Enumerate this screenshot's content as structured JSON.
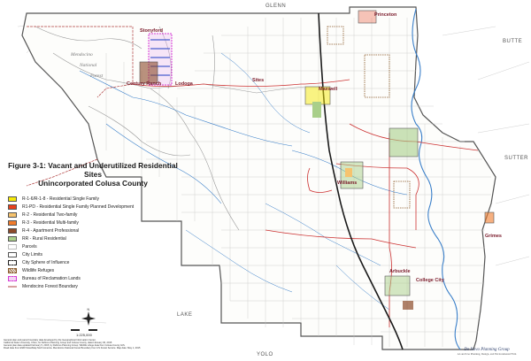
{
  "legend": {
    "title_line1": "Figure 3-1: Vacant and Underutilized Residential Sites",
    "title_line2": "Unincorporated Colusa County",
    "items": [
      {
        "label": "R-1-6/R-1-8 - Residential Single Family",
        "color": "#f5e90a",
        "style": "fill"
      },
      {
        "label": "R1-PD - Residential Single Family Planned Development",
        "color": "#e8401c",
        "style": "fill"
      },
      {
        "label": "R-2 - Residential Two-family",
        "color": "#f6c36e",
        "style": "fill"
      },
      {
        "label": "R-3 - Residential Multi-family",
        "color": "#f07b2c",
        "style": "fill"
      },
      {
        "label": "R-4 - Apartment Professional",
        "color": "#8c4a2a",
        "style": "fill"
      },
      {
        "label": "RR - Rural Residential",
        "color": "#a9cf8a",
        "style": "fill"
      },
      {
        "label": "Parcels",
        "color": "#bbbbbb",
        "style": "outline"
      },
      {
        "label": "City Limits",
        "color": "#555555",
        "style": "outline"
      },
      {
        "label": "City Sphere of Influence",
        "color": "#222222",
        "style": "dashed"
      },
      {
        "label": "Wildlife Refuges",
        "color": "#8a5a2a",
        "style": "hatch"
      },
      {
        "label": "Bureau of Reclamation Lands",
        "color": "#d63ad6",
        "style": "dashed-pink"
      },
      {
        "label": "Mendocino Forest Boundary",
        "color": "#b04040",
        "style": "line"
      }
    ]
  },
  "adjacent_counties": {
    "north": "GLENN",
    "northeast": "BUTTE",
    "east": "SUTTER",
    "south": "YOLO",
    "southwest": "LAKE"
  },
  "forest_label": [
    "Mendocino",
    "National",
    "Forest"
  ],
  "places": {
    "stonyford": "Stonyford",
    "century_ranch": "Century Ranch",
    "lodoga": "Lodoga",
    "sites": "Sites",
    "princeton": "Princeton",
    "maxwell": "Maxwell",
    "williams": "Williams",
    "grimes": "Grimes",
    "arbuckle": "Arbuckle",
    "college_city": "College City"
  },
  "scale_text": "1:225,000",
  "footnote": [
    "General plan and parcel boundary data developed by the Geographical Information Center,",
    "California State University, Chico, for DeNovo Planning Group and Colusa County, dated January 30, 2015",
    "General plan data updated February 5, 2015, by DeNovo Planning Group. Wildlife refuge data from Colusa County GIS.",
    "Road data from ESRI StreetMap North America. Mendocino National Forest Boundary from US Forest Service. Map date: May 1, 2015"
  ],
  "branding": {
    "name": "De Novo Planning Group",
    "tagline": "A Land Use Planning, Design, and Environmental Firm"
  },
  "colors": {
    "county_outline": "#555555",
    "highway": "#cc3333",
    "interstate": "#1a1a1a",
    "water": "#3a7fc9",
    "roads": "#8a8a8a",
    "forest_boundary": "#b04040"
  }
}
